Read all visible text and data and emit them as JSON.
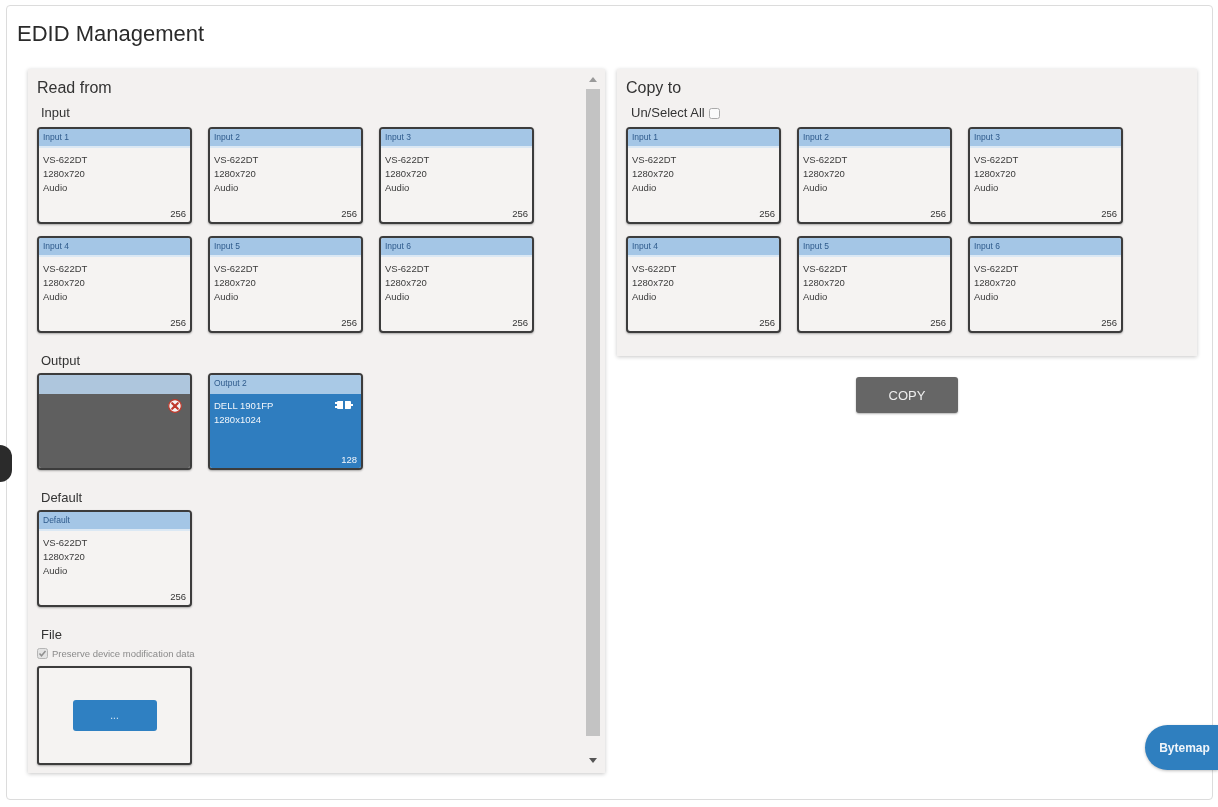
{
  "page": {
    "title": "EDID Management"
  },
  "read_from": {
    "title": "Read from",
    "sections": [
      {
        "kind": "cards",
        "heading": "Input",
        "cards": [
          {
            "header": "Input 1",
            "lines": [
              "VS-622DT",
              "1280x720",
              "Audio"
            ],
            "size": "256",
            "selected": false
          },
          {
            "header": "Input 2",
            "lines": [
              "VS-622DT",
              "1280x720",
              "Audio"
            ],
            "size": "256",
            "selected": false
          },
          {
            "header": "Input 3",
            "lines": [
              "VS-622DT",
              "1280x720",
              "Audio"
            ],
            "size": "256",
            "selected": false
          },
          {
            "header": "Input 4",
            "lines": [
              "VS-622DT",
              "1280x720",
              "Audio"
            ],
            "size": "256",
            "selected": false
          },
          {
            "header": "Input 5",
            "lines": [
              "VS-622DT",
              "1280x720",
              "Audio"
            ],
            "size": "256",
            "selected": false
          },
          {
            "header": "Input 6",
            "lines": [
              "VS-622DT",
              "1280x720",
              "Audio"
            ],
            "size": "256",
            "selected": false
          }
        ]
      },
      {
        "kind": "cards",
        "heading": "Output",
        "cards": [
          {
            "selected": false,
            "connected": false
          },
          {
            "header": "Output 2",
            "lines": [
              "DELL 1901FP",
              "1280x1024"
            ],
            "size": "128",
            "selected": true,
            "connected": true
          }
        ]
      },
      {
        "kind": "cards",
        "heading": "Default",
        "cards": [
          {
            "header": "Default",
            "lines": [
              "VS-622DT",
              "1280x720",
              "Audio"
            ],
            "size": "256",
            "selected": false
          }
        ]
      },
      {
        "kind": "file",
        "heading": "File",
        "preserve": {
          "label": "Preserve device modification data",
          "checked": true,
          "disabled": true
        },
        "browse_button": "..."
      }
    ]
  },
  "copy_to": {
    "title": "Copy to",
    "select_all": {
      "label": "Un/Select All",
      "checked": false
    },
    "cards": [
      {
        "header": "Input 1",
        "lines": [
          "VS-622DT",
          "1280x720",
          "Audio"
        ],
        "size": "256",
        "selected": false
      },
      {
        "header": "Input 2",
        "lines": [
          "VS-622DT",
          "1280x720",
          "Audio"
        ],
        "size": "256",
        "selected": false
      },
      {
        "header": "Input 3",
        "lines": [
          "VS-622DT",
          "1280x720",
          "Audio"
        ],
        "size": "256",
        "selected": false
      },
      {
        "header": "Input 4",
        "lines": [
          "VS-622DT",
          "1280x720",
          "Audio"
        ],
        "size": "256",
        "selected": false
      },
      {
        "header": "Input 5",
        "lines": [
          "VS-622DT",
          "1280x720",
          "Audio"
        ],
        "size": "256",
        "selected": false
      },
      {
        "header": "Input 6",
        "lines": [
          "VS-622DT",
          "1280x720",
          "Audio"
        ],
        "size": "256",
        "selected": false
      }
    ],
    "button": "COPY"
  },
  "bytemap_button": "Bytemap"
}
